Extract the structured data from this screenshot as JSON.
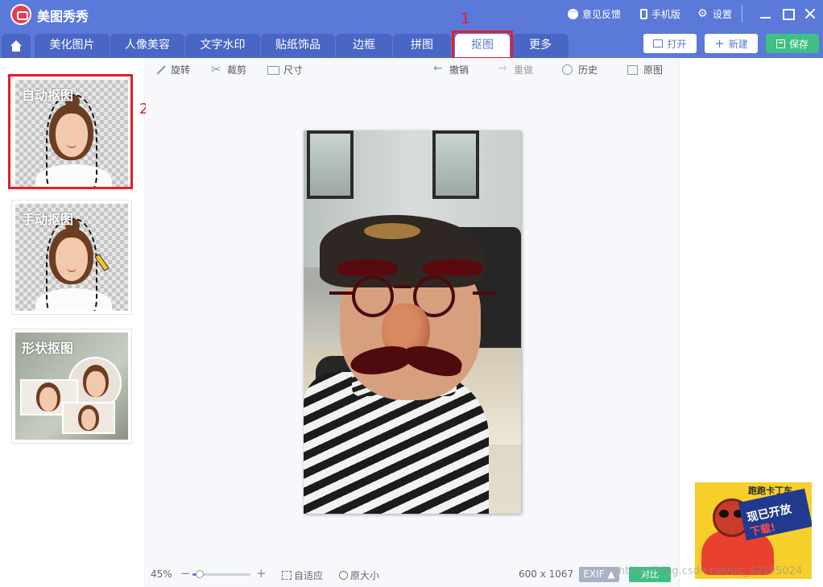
{
  "app": {
    "title": "美图秀秀"
  },
  "titlebar": {
    "feedback": "意见反馈",
    "mobile": "手机版",
    "settings": "设置"
  },
  "tabs": [
    {
      "label": "美化图片"
    },
    {
      "label": "人像美容"
    },
    {
      "label": "文字水印"
    },
    {
      "label": "贴纸饰品"
    },
    {
      "label": "边框"
    },
    {
      "label": "拼图"
    },
    {
      "label": "抠图",
      "active": true
    },
    {
      "label": "更多"
    }
  ],
  "actions": {
    "open": "打开",
    "new": "新建",
    "save": "保存"
  },
  "annotations": {
    "tab_marker": "1",
    "card_marker": "2",
    "color": "#e41e26"
  },
  "cutout_modes": [
    {
      "label": "自动抠图"
    },
    {
      "label": "手动抠图"
    },
    {
      "label": "形状抠图"
    }
  ],
  "toolbar": {
    "rotate": "旋转",
    "crop": "裁剪",
    "size": "尺寸",
    "undo": "撤销",
    "redo": "重做",
    "history": "历史",
    "original": "原图"
  },
  "statusbar": {
    "zoom": "45%",
    "zoom_value": 0.12,
    "fit": "自适应",
    "actual_size": "原大小",
    "image_size": "600 x 1067",
    "exif": "EXIF ▲",
    "compare": "对比"
  },
  "ad": {
    "logo_text": "跑跑卡丁车",
    "headline": "现已开放",
    "subline": "下载!"
  },
  "watermark": "https://blog.csdn.net/qq_42195024",
  "colors": {
    "brand": "#5b79d8",
    "save": "#3fc083",
    "exif": "#a9b1c6"
  }
}
